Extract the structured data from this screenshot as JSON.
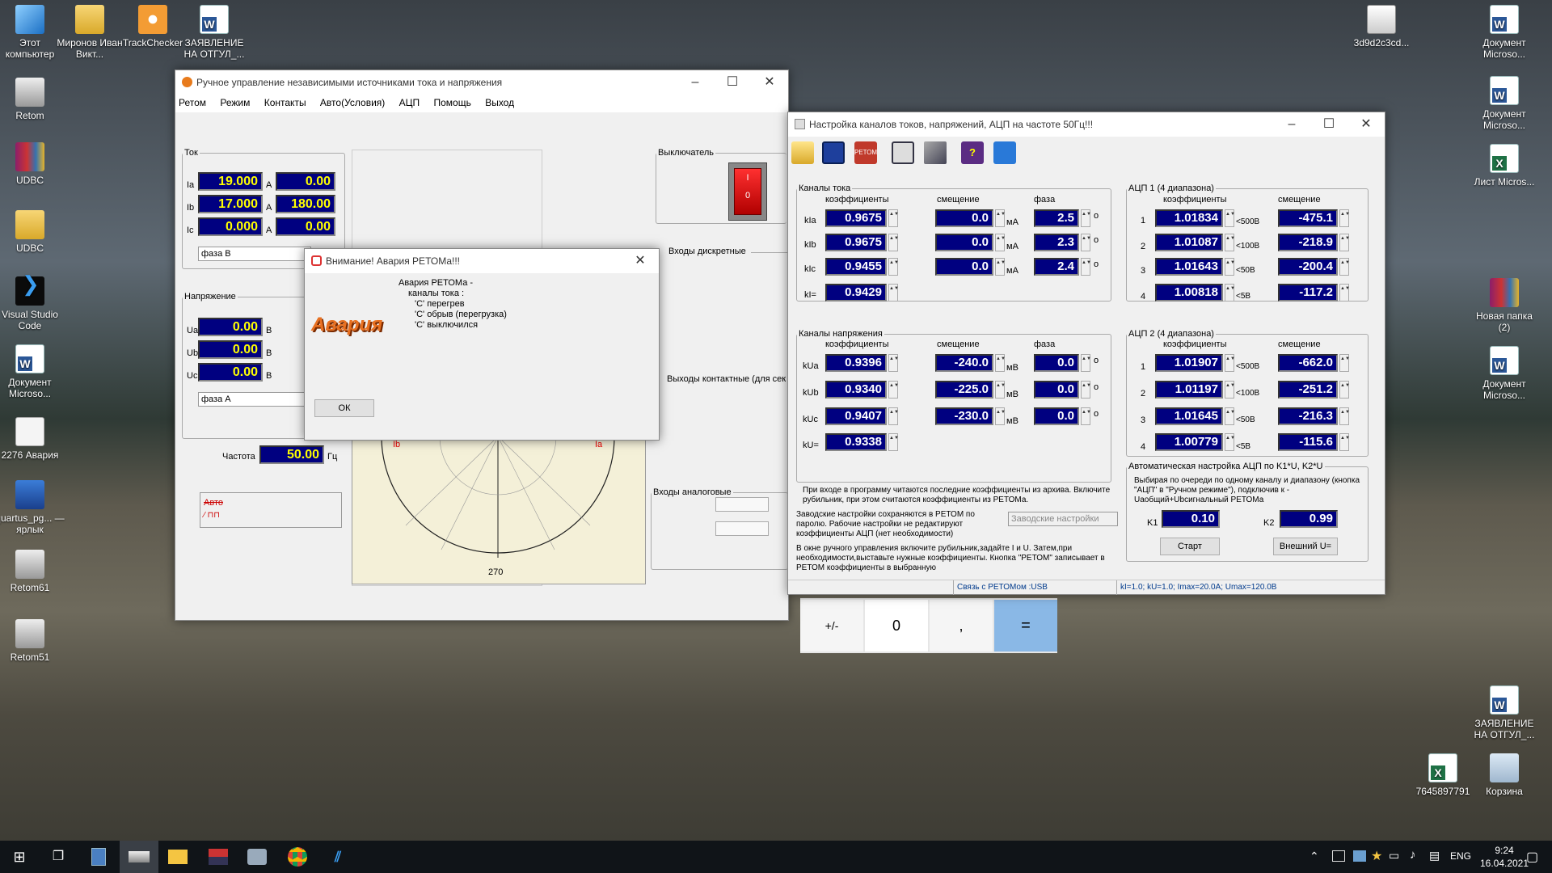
{
  "desktop": {
    "left_icons": [
      "Этот компьютер",
      "Миронов Иван Викт...",
      "TrackChecker",
      "ЗАЯВЛЕНИЕ НА ОТГУЛ_...",
      "Retom",
      "UDBC",
      "UDBC",
      "Visual Studio Code",
      "Документ Microso...",
      "2276 Авария",
      "quartus_pg... — ярлык",
      "Retom61",
      "Retom51"
    ],
    "right_icons": [
      "3d9d2c3cd...",
      "Документ Microso...",
      "Документ Microso...",
      "Лист Micros...",
      "Новая папка (2)",
      "Документ Microso...",
      "ЗАЯВЛЕНИЕ НА ОТГУЛ_...",
      "7645897791",
      "Корзина"
    ]
  },
  "manual_window": {
    "title": "Ручное управление независимыми источниками тока и напряжения",
    "menu": [
      "Ретом",
      "Режим",
      "Контакты",
      "Авто(Условия)",
      "АЦП",
      "Помощь",
      "Выход"
    ],
    "current_group": "Ток",
    "current_rows": [
      {
        "label": "Ia",
        "value": "19.000",
        "unit": "A",
        "phase": "0.00"
      },
      {
        "label": "Ib",
        "value": "17.000",
        "unit": "A",
        "phase": "180.00"
      },
      {
        "label": "Ic",
        "value": "0.000",
        "unit": "A",
        "phase": "0.00"
      }
    ],
    "current_phase_select": "фаза В",
    "voltage_group": "Напряжение",
    "voltage_rows": [
      {
        "label": "Ua",
        "value": "0.00",
        "unit": "В"
      },
      {
        "label": "Ub",
        "value": "0.00",
        "unit": "В"
      },
      {
        "label": "Uc",
        "value": "0.00",
        "unit": "В"
      }
    ],
    "voltage_phase_select": "фаза А",
    "freq_label": "Частота",
    "freq_value": "50.00",
    "freq_unit": "Гц",
    "auto_label": "Авто",
    "breaker_label": "Выключатель",
    "breaker_on": "I",
    "breaker_off": "0",
    "discrete_label": "Входы дискретные",
    "contact_label": "Выходы контактные (для сек",
    "analog_label": "Входы аналоговые",
    "diagram": {
      "left": "180",
      "right": "0",
      "bottom": "270",
      "ib": "Ib",
      "ia": "Ia"
    }
  },
  "alert_dialog": {
    "title": "Внимание! Авария РЕТОМа!!!",
    "image_text": "Авария",
    "lines": [
      "Авария РЕТОМа -",
      "каналы тока :",
      "'C' перегрев",
      "'C' обрыв (перегрузка)",
      "'C' выключился"
    ],
    "ok": "ОК"
  },
  "calib_window": {
    "title": "Настройка каналов токов, напряжений, АЦП на частоте 50Гц!!!",
    "current_group": "Каналы тока",
    "hdr_coef": "коэффициенты",
    "hdr_offset": "смещение",
    "hdr_phase": "фаза",
    "current_rows": [
      {
        "label": "kIa",
        "coef": "0.9675",
        "offset": "0.0",
        "ou": "мА",
        "phase": "2.5"
      },
      {
        "label": "kIb",
        "coef": "0.9675",
        "offset": "0.0",
        "ou": "мА",
        "phase": "2.3"
      },
      {
        "label": "kIc",
        "coef": "0.9455",
        "offset": "0.0",
        "ou": "мА",
        "phase": "2.4"
      },
      {
        "label": "kI=",
        "coef": "0.9429"
      }
    ],
    "voltage_group": "Каналы напряжения",
    "voltage_rows": [
      {
        "label": "kUa",
        "coef": "0.9396",
        "offset": "-240.0",
        "ou": "мВ",
        "phase": "0.0"
      },
      {
        "label": "kUb",
        "coef": "0.9340",
        "offset": "-225.0",
        "ou": "мВ",
        "phase": "0.0"
      },
      {
        "label": "kUc",
        "coef": "0.9407",
        "offset": "-230.0",
        "ou": "мВ",
        "phase": "0.0"
      },
      {
        "label": "kU=",
        "coef": "0.9338"
      }
    ],
    "degree": "о",
    "adc1_group": "АЦП 1   (4 диапазона)",
    "adc1_rows": [
      {
        "n": "1",
        "coef": "1.01834",
        "range": "<500В",
        "offset": "-475.1"
      },
      {
        "n": "2",
        "coef": "1.01087",
        "range": "<100В",
        "offset": "-218.9"
      },
      {
        "n": "3",
        "coef": "1.01643",
        "range": "<50В",
        "offset": "-200.4"
      },
      {
        "n": "4",
        "coef": "1.00818",
        "range": "<5В",
        "offset": "-117.2"
      }
    ],
    "adc2_group": "АЦП 2   (4 диапазона)",
    "adc2_rows": [
      {
        "n": "1",
        "coef": "1.01907",
        "range": "<500В",
        "offset": "-662.0"
      },
      {
        "n": "2",
        "coef": "1.01197",
        "range": "<100В",
        "offset": "-251.2"
      },
      {
        "n": "3",
        "coef": "1.01645",
        "range": "<50В",
        "offset": "-216.3"
      },
      {
        "n": "4",
        "coef": "1.00779",
        "range": "<5В",
        "offset": "-115.6"
      }
    ],
    "auto_group": "Автоматическая настройка АЦП по K1*U, K2*U",
    "auto_text": "Выбирая по очереди по одному каналу и диапазону (кнопка \"АЦП\" в \"Ручном режиме\"), подключив к -Uaобщий+Ubсигнальный РЕТОМа",
    "k1_label": "K1",
    "k1": "0.10",
    "k2_label": "K2",
    "k2": "0.99",
    "start": "Старт",
    "ext": "Внешний U=",
    "info1": "При входе в программу читаются последние коэффициенты из архива. Включите рубильник, при этом считаются коэффициенты из РЕТОМа.",
    "info2": "Заводские настройки сохраняются в РЕТОМ по паролю. Рабочие настройки не редактируют коэффициенты АЦП (нет необходимости)",
    "factory_select": "Заводские настройки",
    "info3": "В окне ручного управления включите рубильник,задайте I и U. Затем,при необходимости,выставьте нужные коэффициенты. Кнопка \"РЕТОМ\" записывает в РЕТОМ коэффициенты  в выбранную",
    "status_link": "Связь с РЕТОМом :USB",
    "status_info": "kI=1.0; kU=1.0; Imax=20.0A; Umax=120.0B",
    "toolbar_retom": "РЕТОМ"
  },
  "calculator": {
    "keys": [
      "+/-",
      "0",
      ",",
      "="
    ]
  },
  "taskbar": {
    "lang": "ENG",
    "time": "9:24",
    "date": "16.04.2021"
  },
  "colors": {
    "value_bg": "#000080",
    "value_fg": "#ffff00",
    "accent": "#0078d7"
  }
}
